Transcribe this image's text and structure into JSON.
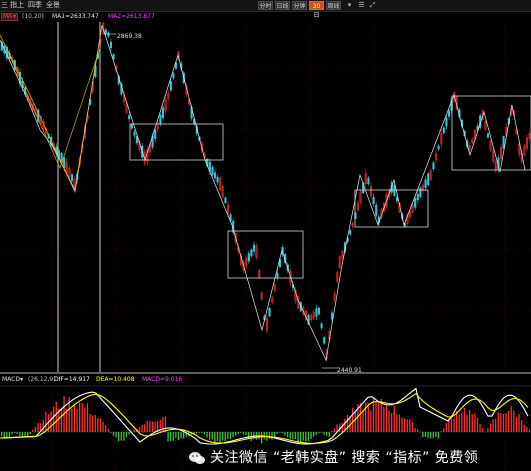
{
  "toolbar": {
    "left_items": [
      "三",
      "指上",
      "四季",
      "全景"
    ],
    "periods": [
      "分时",
      "日线",
      "分钟",
      "30日",
      "周线"
    ],
    "active_period": "30日"
  },
  "ma_legend": {
    "name": "MA",
    "params": "(10,20)",
    "ma1": "MA1=2633.747",
    "ma2": "MA2=2613.877"
  },
  "price_annotations": {
    "high": "2869.38",
    "low": "2440.91"
  },
  "macd_legend": {
    "name": "MACD",
    "params": "(26,12,9)",
    "dif": "DIF=14.917",
    "dea": "DEA=10.408",
    "macd": "MACD=9.016"
  },
  "watermark": {
    "text": "关注微信 “老韩实盘” 搜索 “指标” 免费领"
  },
  "colors": {
    "up": "#ff3030",
    "down": "#30c8d8",
    "macd_pos": "#ff3030",
    "macd_neg": "#40c040",
    "dif_line": "#ffffff",
    "dea_line": "#ffff00",
    "grid": "#7a0000",
    "box": "#d8d8d8",
    "accent": "#c8501a"
  }
}
